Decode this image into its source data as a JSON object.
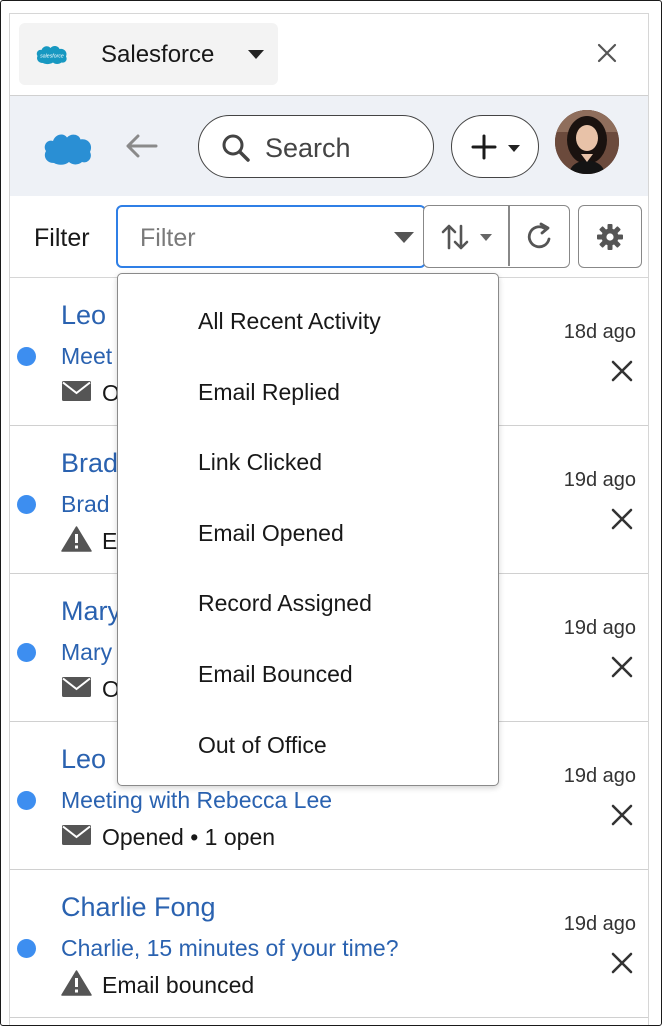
{
  "app_header": {
    "app_name": "Salesforce",
    "logo_text": "salesforce"
  },
  "toolbar": {
    "search_label": "Search"
  },
  "filter_bar": {
    "label": "Filter",
    "placeholder": "Filter"
  },
  "dropdown": {
    "items": [
      "All Recent Activity",
      "Email Replied",
      "Link Clicked",
      "Email Opened",
      "Record Assigned",
      "Email Bounced",
      "Out of Office"
    ]
  },
  "activities": [
    {
      "name": "Leo",
      "subject": "Meet",
      "status": "O",
      "status_icon": "envelope-icon",
      "time": "18d ago",
      "unread": true
    },
    {
      "name": "Brad",
      "subject": "Brad",
      "status": "E",
      "status_icon": "warning-icon",
      "time": "19d ago",
      "unread": true
    },
    {
      "name": "Mary",
      "subject": "Mary",
      "status": "O",
      "status_icon": "envelope-icon",
      "time": "19d ago",
      "unread": true
    },
    {
      "name": "Leo",
      "subject": "Meeting with Rebecca Lee",
      "status": "Opened • 1 open",
      "status_icon": "envelope-icon",
      "time": "19d ago",
      "unread": true
    },
    {
      "name": "Charlie Fong",
      "subject": "Charlie, 15 minutes of your time?",
      "status": "Email bounced",
      "status_icon": "warning-icon",
      "time": "19d ago",
      "unread": true
    }
  ],
  "colors": {
    "accent": "#2f7fe6",
    "link": "#2a62b0",
    "unread_dot": "#3d8ef0",
    "salesforce_blue": "#1798c1",
    "toolbar_bg": "#eef1f6"
  }
}
